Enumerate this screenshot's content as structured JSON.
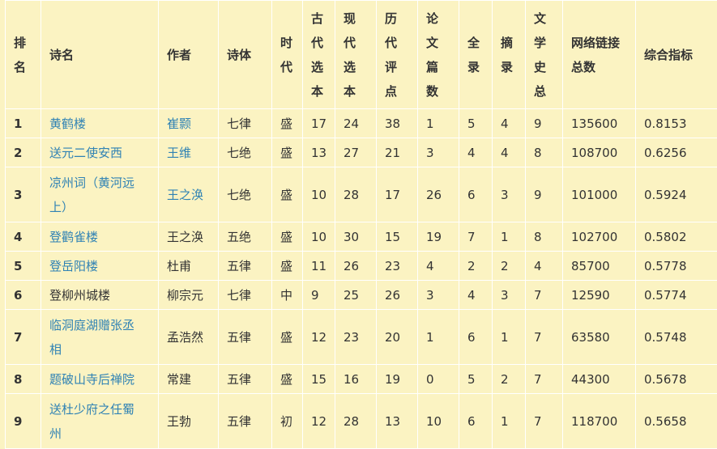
{
  "table": {
    "headers": [
      {
        "key": "rank",
        "chars": [
          "排",
          "名"
        ]
      },
      {
        "key": "title",
        "text": "诗名"
      },
      {
        "key": "author",
        "text": "作者"
      },
      {
        "key": "form",
        "text": "诗体"
      },
      {
        "key": "era",
        "chars": [
          "时",
          "代"
        ]
      },
      {
        "key": "ancient",
        "chars": [
          "古",
          "代",
          "选",
          "本"
        ]
      },
      {
        "key": "modern",
        "chars": [
          "现",
          "代",
          "选",
          "本"
        ]
      },
      {
        "key": "comments",
        "chars": [
          "历",
          "代",
          "评",
          "点"
        ]
      },
      {
        "key": "papers",
        "chars": [
          "论",
          "文",
          "篇",
          "数"
        ]
      },
      {
        "key": "quanlu",
        "chars": [
          "全",
          "录"
        ]
      },
      {
        "key": "zhailu",
        "chars": [
          "摘",
          "录"
        ]
      },
      {
        "key": "lithist",
        "chars": [
          "文",
          "学",
          "史",
          "总"
        ]
      },
      {
        "key": "links",
        "lines": [
          "网络链接",
          "总数"
        ]
      },
      {
        "key": "index",
        "text": "综合指标"
      }
    ],
    "rows": [
      {
        "rank": "1",
        "title": [
          "黄鹤楼"
        ],
        "title_link": true,
        "author": "崔颢",
        "author_link": true,
        "form": "七律",
        "era": "盛",
        "ancient": "17",
        "modern": "24",
        "comments": "38",
        "papers": "1",
        "quanlu": "5",
        "zhailu": "4",
        "lithist": "9",
        "links": "135600",
        "index": "0.8153"
      },
      {
        "rank": "2",
        "title": [
          "送元二使安西"
        ],
        "title_link": true,
        "author": "王维",
        "author_link": true,
        "form": "七绝",
        "era": "盛",
        "ancient": "13",
        "modern": "27",
        "comments": "21",
        "papers": "3",
        "quanlu": "4",
        "zhailu": "4",
        "lithist": "8",
        "links": "108700",
        "index": "0.6256"
      },
      {
        "rank": "3",
        "title": [
          "凉州词（黄河远",
          "上）"
        ],
        "title_link": true,
        "author": "王之涣",
        "author_link": true,
        "form": "七绝",
        "era": "盛",
        "ancient": "10",
        "modern": "28",
        "comments": "17",
        "papers": "26",
        "quanlu": "6",
        "zhailu": "3",
        "lithist": "9",
        "links": "101000",
        "index": "0.5924"
      },
      {
        "rank": "4",
        "title": [
          "登鹳雀楼"
        ],
        "title_link": true,
        "author": "王之涣",
        "author_link": false,
        "form": "五绝",
        "era": "盛",
        "ancient": "10",
        "modern": "30",
        "comments": "15",
        "papers": "19",
        "quanlu": "7",
        "zhailu": "1",
        "lithist": "8",
        "links": "102700",
        "index": "0.5802"
      },
      {
        "rank": "5",
        "title": [
          "登岳阳楼"
        ],
        "title_link": true,
        "author": "杜甫",
        "author_link": false,
        "form": "五律",
        "era": "盛",
        "ancient": "11",
        "modern": "26",
        "comments": "23",
        "papers": "4",
        "quanlu": "2",
        "zhailu": "2",
        "lithist": "4",
        "links": "85700",
        "index": "0.5778"
      },
      {
        "rank": "6",
        "title": [
          "登柳州城楼"
        ],
        "title_link": false,
        "author": "柳宗元",
        "author_link": false,
        "form": "七律",
        "era": "中",
        "ancient": "9",
        "modern": "25",
        "comments": "26",
        "papers": "3",
        "quanlu": "4",
        "zhailu": "3",
        "lithist": "7",
        "links": "12590",
        "index": "0.5774"
      },
      {
        "rank": "7",
        "title": [
          "临洞庭湖赠张丞",
          "相"
        ],
        "title_link": true,
        "author": "孟浩然",
        "author_link": false,
        "form": "五律",
        "era": "盛",
        "ancient": "12",
        "modern": "23",
        "comments": "20",
        "papers": "1",
        "quanlu": "6",
        "zhailu": "1",
        "lithist": "7",
        "links": "63580",
        "index": "0.5748"
      },
      {
        "rank": "8",
        "title": [
          "题破山寺后禅院"
        ],
        "title_link": true,
        "author": "常建",
        "author_link": false,
        "form": "五律",
        "era": "盛",
        "ancient": "15",
        "modern": "16",
        "comments": "19",
        "papers": "0",
        "quanlu": "5",
        "zhailu": "2",
        "lithist": "7",
        "links": "44300",
        "index": "0.5678"
      },
      {
        "rank": "9",
        "title": [
          "送杜少府之任蜀",
          "州"
        ],
        "title_link": true,
        "author": "王勃",
        "author_link": false,
        "form": "五律",
        "era": "初",
        "ancient": "12",
        "modern": "28",
        "comments": "13",
        "papers": "10",
        "quanlu": "6",
        "zhailu": "1",
        "lithist": "7",
        "links": "118700",
        "index": "0.5658"
      }
    ]
  },
  "colors": {
    "background": "#fbf3c2",
    "link": "#2f82b4",
    "text": "#333333",
    "border": "#ffffff"
  }
}
